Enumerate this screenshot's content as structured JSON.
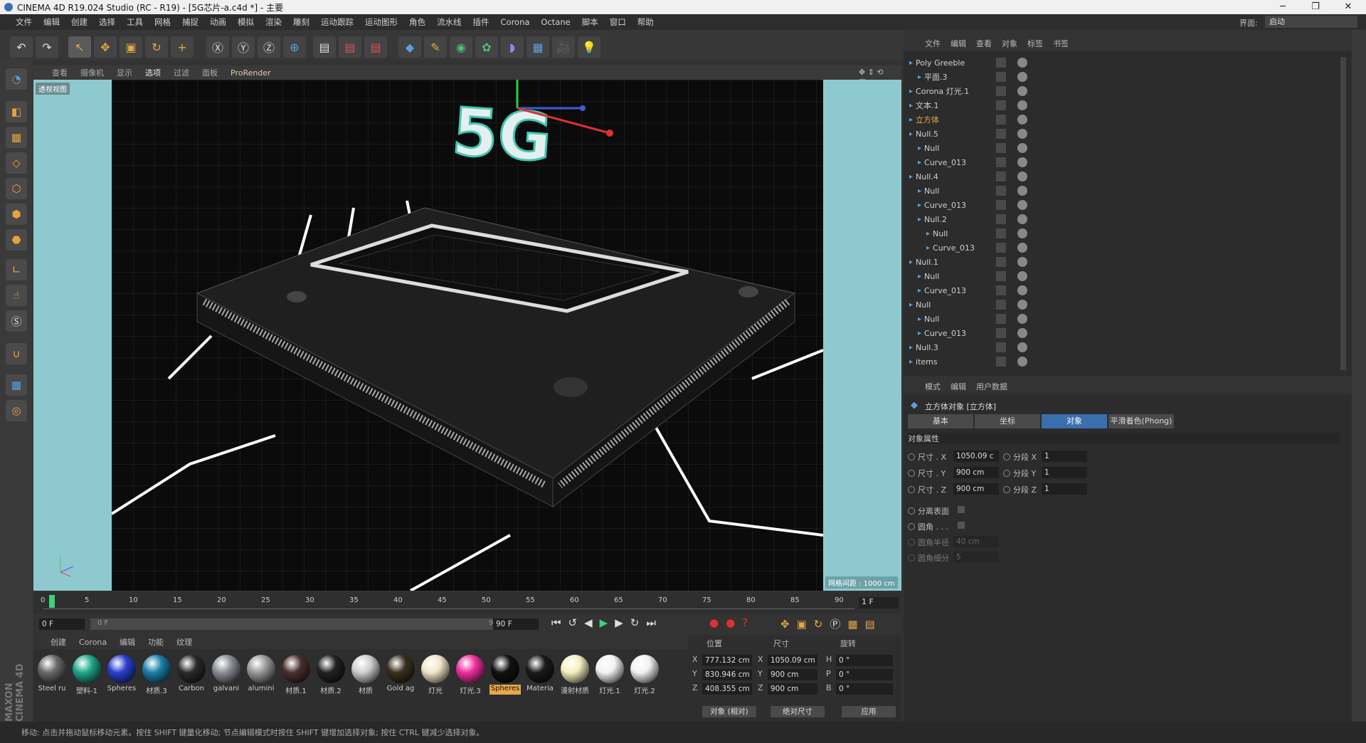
{
  "window": {
    "title": "CINEMA 4D R19.024 Studio (RC - R19) - [5G芯片-a.c4d *] - 主要"
  },
  "menu": [
    "文件",
    "编辑",
    "创建",
    "选择",
    "工具",
    "网格",
    "捕捉",
    "动画",
    "模拟",
    "渲染",
    "雕刻",
    "运动跟踪",
    "运动图形",
    "角色",
    "流水线",
    "插件",
    "Corona",
    "Octane",
    "脚本",
    "窗口",
    "帮助"
  ],
  "layout": {
    "label": "界面:",
    "value": "启动"
  },
  "viewport": {
    "menu": [
      "查看",
      "摄像机",
      "显示",
      "选项",
      "过滤",
      "面板",
      "ProRender"
    ],
    "view_name": "透视视图",
    "grid_info": "网格间距 : 1000 cm"
  },
  "timeline": {
    "ticks": [
      "0",
      "5",
      "10",
      "15",
      "20",
      "25",
      "30",
      "35",
      "40",
      "45",
      "50",
      "55",
      "60",
      "65",
      "70",
      "75",
      "80",
      "85",
      "90"
    ],
    "end_frame": "1 F",
    "current": "0 F",
    "range_start": "0 F",
    "range_end": "90 F",
    "range_end2": "90 F"
  },
  "materials": {
    "tabs": [
      "创建",
      "Corona",
      "编辑",
      "功能",
      "纹理"
    ],
    "items": [
      {
        "label": "Steel ru",
        "color": "#6a6a6a"
      },
      {
        "label": "塑料-1",
        "color": "#1fa88a"
      },
      {
        "label": "Spheres",
        "color": "#2b3fcf"
      },
      {
        "label": "材质.3",
        "color": "#1c7fa6"
      },
      {
        "label": "Carbon",
        "color": "#2b2b2b"
      },
      {
        "label": "galvani",
        "color": "#8a8e94"
      },
      {
        "label": "alumini",
        "color": "#9a9a9a"
      },
      {
        "label": "材质.1",
        "color": "#4a2f2f"
      },
      {
        "label": "材质.2",
        "color": "#222222"
      },
      {
        "label": "材质",
        "color": "#cfcfcf"
      },
      {
        "label": "Gold ag",
        "color": "#3a3020"
      },
      {
        "label": "灯光",
        "color": "#f1e6c8"
      },
      {
        "label": "灯光.3",
        "color": "#f02fa0"
      },
      {
        "label": "Spheres",
        "color": "#111111"
      },
      {
        "label": "Materia",
        "color": "#1a1a1a"
      },
      {
        "label": "漫射材质",
        "color": "#f5f0c0"
      },
      {
        "label": "灯光.1",
        "color": "#f2f2f2"
      },
      {
        "label": "灯光.2",
        "color": "#f2f2f2"
      }
    ],
    "selected_index": 13
  },
  "coords": {
    "headers": [
      "位置",
      "尺寸",
      "旋转"
    ],
    "rows": [
      {
        "axis": "X",
        "pos": "777.132 cm",
        "saxis": "X",
        "size": "1050.09 cm",
        "raxis": "H",
        "rot": "0 °"
      },
      {
        "axis": "Y",
        "pos": "830.946 cm",
        "saxis": "Y",
        "size": "900 cm",
        "raxis": "P",
        "rot": "0 °"
      },
      {
        "axis": "Z",
        "pos": "408.355 cm",
        "saxis": "Z",
        "size": "900 cm",
        "raxis": "B",
        "rot": "0 °"
      }
    ],
    "mode": "对象 (相对)",
    "size_mode": "绝对尺寸",
    "apply": "应用"
  },
  "status": "移动: 点击并拖动鼠标移动元素。按住 SHIFT 键量化移动; 节点编辑模式时按住 SHIFT 键增加选择对象; 按住 CTRL 键减少选择对象。",
  "objects": {
    "tabs": [
      "文件",
      "编辑",
      "查看",
      "对象",
      "标签",
      "书签"
    ],
    "rows": [
      {
        "name": "Poly Greeble",
        "indent": 0
      },
      {
        "name": "平面.3",
        "indent": 1
      },
      {
        "name": "Corona 灯光.1",
        "indent": 0
      },
      {
        "name": "文本.1",
        "indent": 0
      },
      {
        "name": "立方体",
        "indent": 0,
        "selected": true
      },
      {
        "name": "Null.5",
        "indent": 0
      },
      {
        "name": "Null",
        "indent": 1
      },
      {
        "name": "Curve_013",
        "indent": 1
      },
      {
        "name": "Null.4",
        "indent": 0
      },
      {
        "name": "Null",
        "indent": 1
      },
      {
        "name": "Curve_013",
        "indent": 1
      },
      {
        "name": "Null.2",
        "indent": 1
      },
      {
        "name": "Null",
        "indent": 2
      },
      {
        "name": "Curve_013",
        "indent": 2
      },
      {
        "name": "Null.1",
        "indent": 0
      },
      {
        "name": "Null",
        "indent": 1
      },
      {
        "name": "Curve_013",
        "indent": 1
      },
      {
        "name": "Null",
        "indent": 0
      },
      {
        "name": "Null",
        "indent": 1
      },
      {
        "name": "Curve_013",
        "indent": 1
      },
      {
        "name": "Null.3",
        "indent": 0
      },
      {
        "name": "items",
        "indent": 0
      }
    ]
  },
  "attributes": {
    "tabs": [
      "模式",
      "编辑",
      "用户数据"
    ],
    "title": "立方体对象 [立方体]",
    "subtabs": [
      "基本",
      "坐标",
      "对象",
      "平滑着色(Phong)"
    ],
    "active_subtab": 2,
    "section": "对象属性",
    "size_x_label": "尺寸 . X",
    "size_x": "1050.09 c",
    "seg_x_label": "分段 X",
    "seg_x": "1",
    "size_y_label": "尺寸 . Y",
    "size_y": "900 cm",
    "seg_y_label": "分段 Y",
    "seg_y": "1",
    "size_z_label": "尺寸 . Z",
    "size_z": "900 cm",
    "seg_z_label": "分段 Z",
    "seg_z": "1",
    "sep_label": "分离表面",
    "fillet_label": "圆角 . . .",
    "fillet_r_label": "圆角半径",
    "fillet_r": "40 cm",
    "fillet_sub_label": "圆角细分",
    "fillet_sub": "5"
  },
  "scene": {
    "logo_text": "5G"
  }
}
